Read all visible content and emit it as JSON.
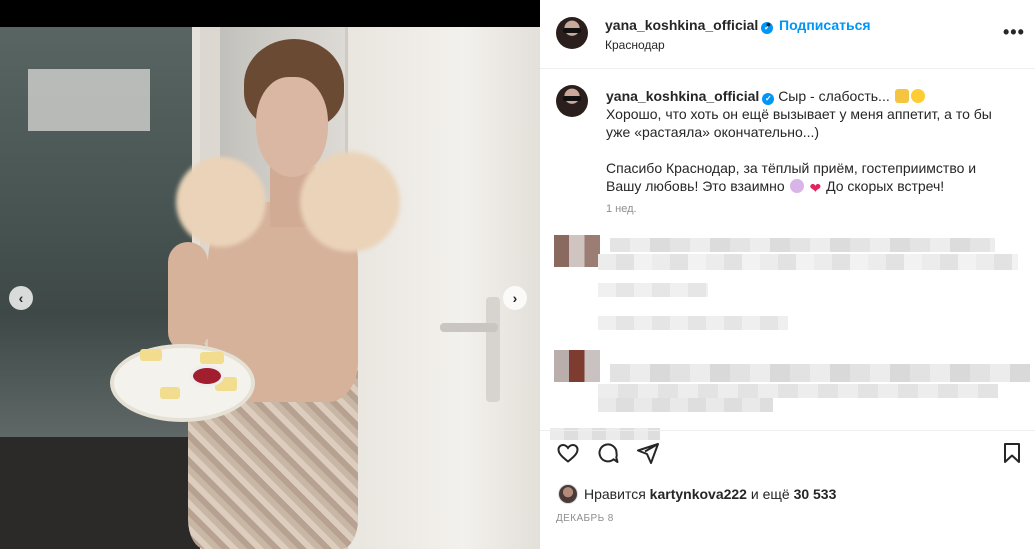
{
  "post": {
    "author": "yana_koshkina_official",
    "follow_label": "Подписаться",
    "separator": "•",
    "location": "Краснодар",
    "more_label": "•••",
    "caption_line1": "Сыр - слабость...",
    "caption_line2": "Хорошо, что хоть он ещё вызывает у меня аппетит, а то бы уже «растаяла» окончательно...)",
    "caption_line3_a": "Спасибо Краснодар, за тёплый приём, гостеприимство и Вашу любовь! Это взаимно",
    "caption_line3_b": "До скорых встреч!",
    "time_ago": "1 нед.",
    "likes_prefix": "Нравится",
    "liked_by": "kartynkova222",
    "likes_middle": "и ещё",
    "likes_count": "30 533",
    "date": "Декабрь 8"
  },
  "carousel": {
    "prev_label": "‹",
    "next_label": "›"
  },
  "icons": {
    "like": "heart-icon",
    "comment": "comment-icon",
    "share": "share-icon",
    "save": "bookmark-icon",
    "verified": "verified-badge-icon"
  },
  "colors": {
    "accent": "#0095f6",
    "text": "#262626",
    "muted": "#8e8e8e"
  }
}
